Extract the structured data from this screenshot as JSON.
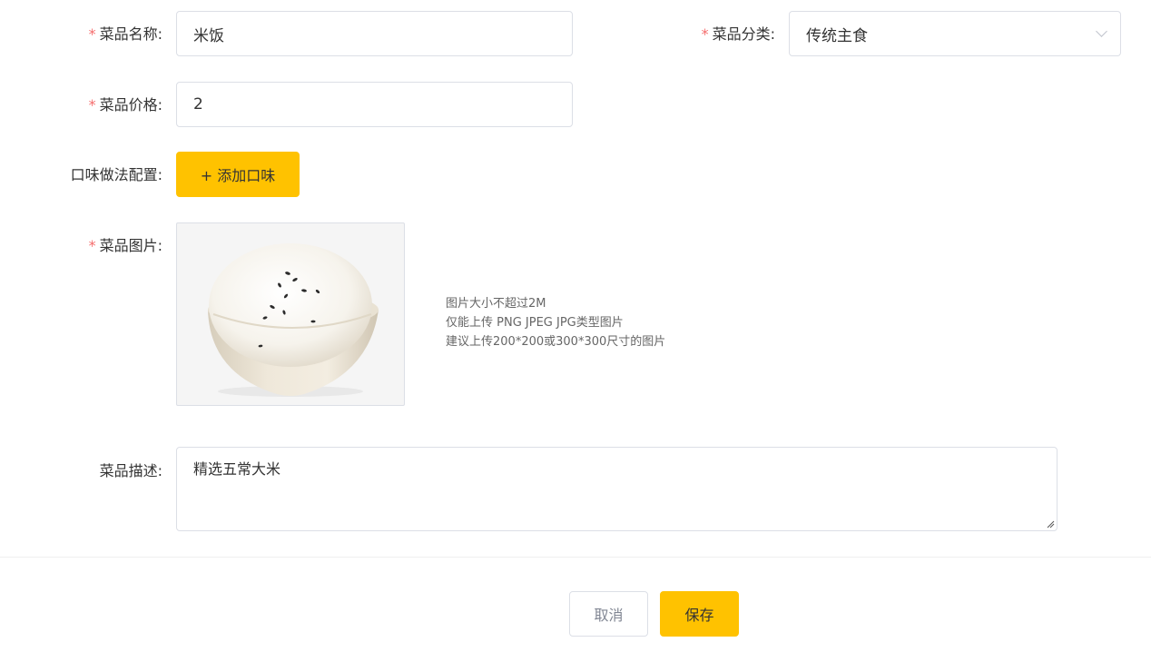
{
  "form": {
    "name": {
      "required_mark": "*",
      "label": "菜品名称:",
      "value": "米饭"
    },
    "category": {
      "required_mark": "*",
      "label": "菜品分类:",
      "value": "传统主食"
    },
    "price": {
      "required_mark": "*",
      "label": "菜品价格:",
      "value": "2"
    },
    "flavor": {
      "label": "口味做法配置:",
      "button_label": "+ 添加口味"
    },
    "image": {
      "required_mark": "*",
      "label": "菜品图片:",
      "tips": [
        "图片大小不超过2M",
        "仅能上传 PNG JPEG JPG类型图片",
        "建议上传200*200或300*300尺寸的图片"
      ]
    },
    "description": {
      "label": "菜品描述:",
      "value": "精选五常大米"
    }
  },
  "footer": {
    "cancel_label": "取消",
    "save_label": "保存"
  },
  "colors": {
    "accent": "#ffc200",
    "required": "#f56c6c",
    "border": "#dcdfe6"
  }
}
